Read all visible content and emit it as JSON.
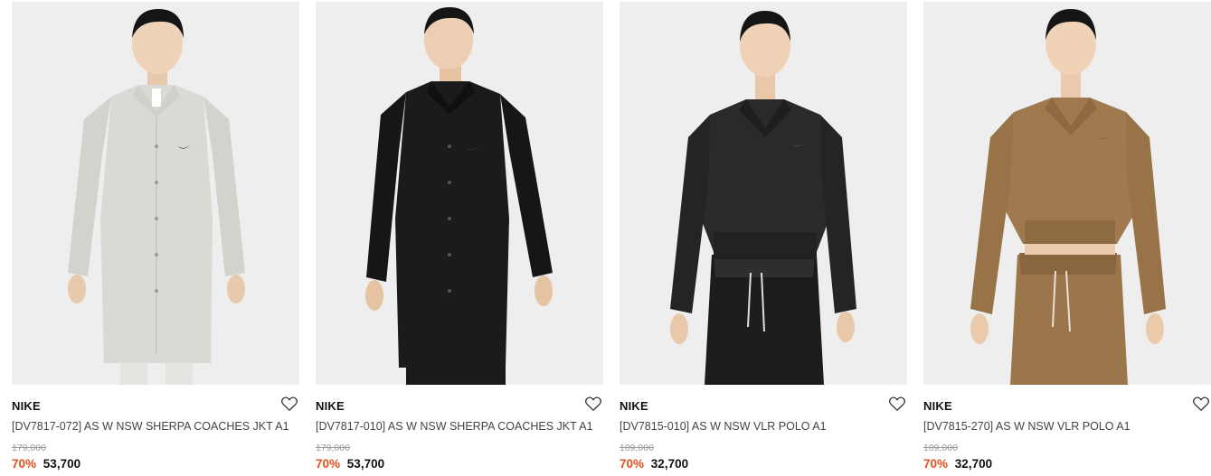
{
  "products": [
    {
      "brand": "NIKE",
      "name": "[DV7817-072] AS W NSW SHERPA COACHES JKT A1",
      "original_price": "179,000",
      "discount": "70%",
      "sale_price": "53,700",
      "garment_color": "#d9dad4",
      "icon": "heart-outline-icon"
    },
    {
      "brand": "NIKE",
      "name": "[DV7817-010] AS W NSW SHERPA COACHES JKT A1",
      "original_price": "179,000",
      "discount": "70%",
      "sale_price": "53,700",
      "garment_color": "#1b1b1d",
      "icon": "heart-outline-icon"
    },
    {
      "brand": "NIKE",
      "name": "[DV7815-010] AS W NSW VLR POLO A1",
      "original_price": "109,000",
      "discount": "70%",
      "sale_price": "32,700",
      "garment_color": "#2a2a2a",
      "icon": "heart-outline-icon"
    },
    {
      "brand": "NIKE",
      "name": "[DV7815-270] AS W NSW VLR POLO A1",
      "original_price": "109,000",
      "discount": "70%",
      "sale_price": "32,700",
      "garment_color": "#a07a4e",
      "icon": "heart-outline-icon"
    }
  ],
  "colors": {
    "discount": "#e24f1d",
    "thumb_bg": "#efefef"
  }
}
